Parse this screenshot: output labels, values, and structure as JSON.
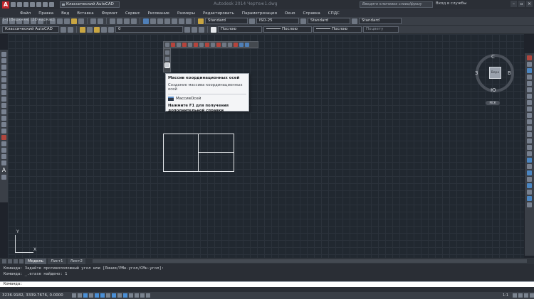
{
  "title_bar": {
    "workspace": "Классический AutoCAD",
    "document_title": "Autodesk 2014  Чертеж1.dwg",
    "search_placeholder": "Введите ключевое слово/фразу",
    "signin": "Вход в службы",
    "win_minimize": "–",
    "win_restore": "▫",
    "win_close": "×"
  },
  "menu": [
    "Файл",
    "Правка",
    "Вид",
    "Вставка",
    "Формат",
    "Сервис",
    "Рисование",
    "Размеры",
    "Редактировать",
    "Параметризация",
    "Окно",
    "Справка",
    "СПДС"
  ],
  "toolbar_styles": {
    "text_style": "Standard",
    "dim_style": "ISO-25",
    "table_style": "Standard",
    "mleader_style": "Standard"
  },
  "toolbar_layers": {
    "workspace": "Классический AutoCAD",
    "layer": "0",
    "color": "Послою",
    "linetype": "Послою",
    "lineweight": "Послою",
    "plot_style": "Поцвету"
  },
  "viewport_label": "[–] [Верхняя] [2D каркас]",
  "tooltip": {
    "title": "Массив координационных осей",
    "description": "Создание массива координационных осей",
    "command": "МассивОсей",
    "help": "Нажмите F1 для получения дополнительной справки"
  },
  "viewcube": {
    "face": "Верх",
    "north": "С",
    "south": "Ю",
    "east": "В",
    "west": "З",
    "wcs": "МСК"
  },
  "ucs": {
    "x": "X",
    "y": "Y"
  },
  "layout_tabs": [
    "Модель",
    "Лист1",
    "Лист2"
  ],
  "command_history": [
    "Команда: Задайте противоположный угол или [Линия/РМн-угол/СМн-угол]:",
    "Команда: _.erase найдено: 1"
  ],
  "command_prompt": "Команда:",
  "status": {
    "coords": "3236.9182, 3339.7676, 0.0000",
    "scale": "1:1"
  },
  "colors": {
    "accent": "#c0262d",
    "background": "#212830"
  }
}
